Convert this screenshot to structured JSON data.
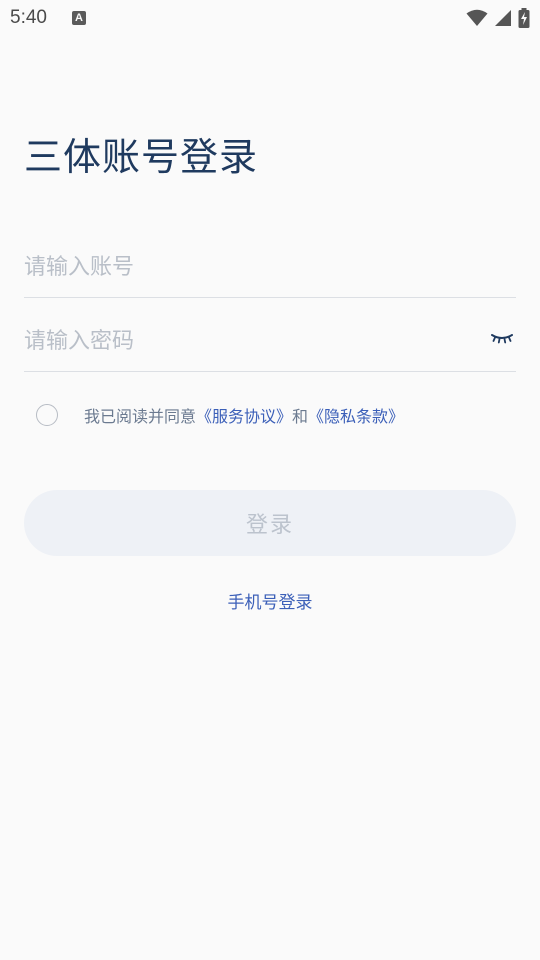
{
  "status_bar": {
    "time": "5:40",
    "notification_icon": "A",
    "icons": [
      "wifi-icon",
      "signal-icon",
      "battery-charging-icon"
    ]
  },
  "login": {
    "title": "三体账号登录",
    "account_placeholder": "请输入账号",
    "account_value": "",
    "password_placeholder": "请输入密码",
    "password_value": "",
    "agreement_prefix": "我已阅读并同意",
    "service_agreement": "《服务协议》",
    "agreement_and": "和",
    "privacy_terms": "《隐私条款》",
    "login_button": "登录",
    "phone_login": "手机号登录"
  },
  "colors": {
    "background": "#fafafa",
    "title": "#1f3a5f",
    "link": "#3b5fb8",
    "button_bg": "#eef1f6",
    "button_text": "#bcc3cd",
    "placeholder": "#b9bfc8"
  }
}
